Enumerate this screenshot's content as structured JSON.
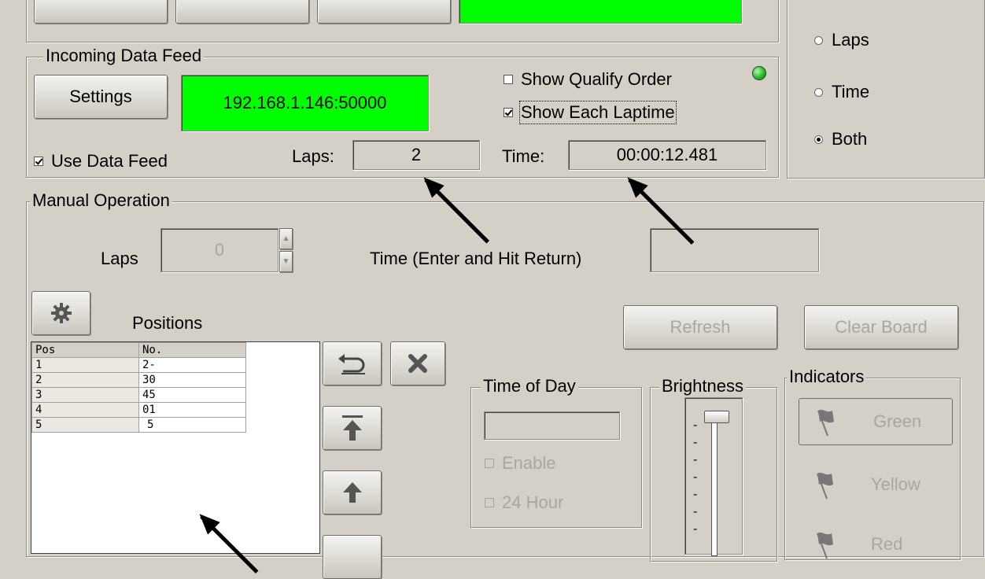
{
  "top_status": {
    "color": "#00ff00"
  },
  "feed": {
    "title": "Incoming Data Feed",
    "settings_label": "Settings",
    "address": "192.168.1.146:50000",
    "show_qualify_order": "Show Qualify Order",
    "show_each_laptime": "Show Each Laptime",
    "use_data_feed": "Use Data Feed",
    "laps_label": "Laps:",
    "laps_value": "2",
    "time_label": "Time:",
    "time_value": "00:00:12.481",
    "indicator_color": "#22c022"
  },
  "display_mode": {
    "options": [
      "Laps",
      "Time",
      "Both"
    ],
    "selected": "Both"
  },
  "manual": {
    "title": "Manual Operation",
    "laps_label": "Laps",
    "laps_value": "0",
    "time_label": "Time (Enter and Hit Return)",
    "time_value": "",
    "positions_label": "Positions",
    "refresh_label": "Refresh",
    "clear_label": "Clear Board"
  },
  "positions_table": {
    "headers": [
      "Pos",
      "No."
    ],
    "rows": [
      [
        "1",
        "2-"
      ],
      [
        "2",
        "30"
      ],
      [
        "3",
        "45"
      ],
      [
        "4",
        "01"
      ],
      [
        "5",
        "5"
      ]
    ]
  },
  "time_of_day": {
    "title": "Time of Day",
    "value": "",
    "enable_label": "Enable",
    "hour24_label": "24 Hour"
  },
  "brightness": {
    "title": "Brightness"
  },
  "indicators": {
    "title": "Indicators",
    "green_label": "Green",
    "yellow_label": "Yellow",
    "red_label": "Red"
  }
}
